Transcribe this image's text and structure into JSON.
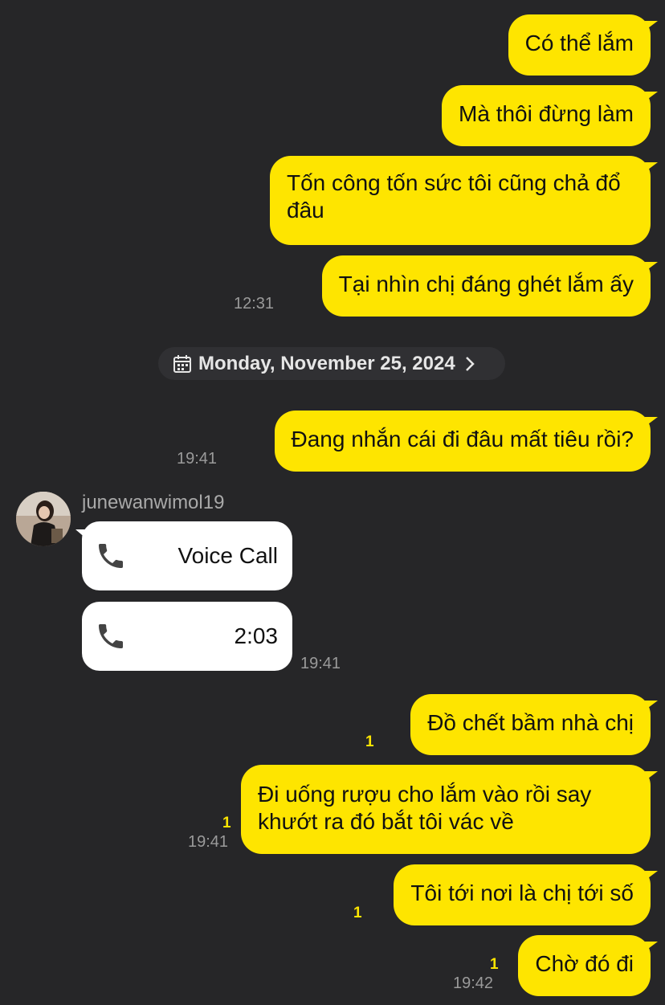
{
  "messages_top": [
    {
      "text": "Có thể lắm"
    },
    {
      "text": "Mà thôi đừng làm"
    },
    {
      "text": "Tốn công tốn sức tôi cũng chả đổ đâu"
    },
    {
      "text": "Tại nhìn chị đáng ghét lắm ấy",
      "time": "12:31"
    }
  ],
  "date_divider": {
    "label": "Monday, November 25, 2024",
    "icon": "calendar-icon"
  },
  "msg_after_date": {
    "text": "Đang nhắn cái đi đâu mất tiêu rồi?",
    "time": "19:41"
  },
  "contact": {
    "name": "junewanwimol19",
    "calls": [
      {
        "label": "Voice Call",
        "icon": "phone-icon"
      },
      {
        "label": "2:03",
        "icon": "phone-icon"
      }
    ],
    "time": "19:41"
  },
  "messages_bottom": [
    {
      "text": "Đồ chết bầm nhà chị",
      "unread": "1"
    },
    {
      "text": "Đi uống rượu cho lắm vào rồi say khướt ra đó bắt tôi vác về",
      "unread": "1",
      "time": "19:41"
    },
    {
      "text": "Tôi tới nơi là chị tới số",
      "unread": "1"
    },
    {
      "text": "Chờ đó đi",
      "unread": "1",
      "time": "19:42"
    }
  ],
  "colors": {
    "background": "#262628",
    "my_bubble": "#FEE500",
    "their_bubble": "#FFFFFF",
    "unread": "#FEE500"
  }
}
